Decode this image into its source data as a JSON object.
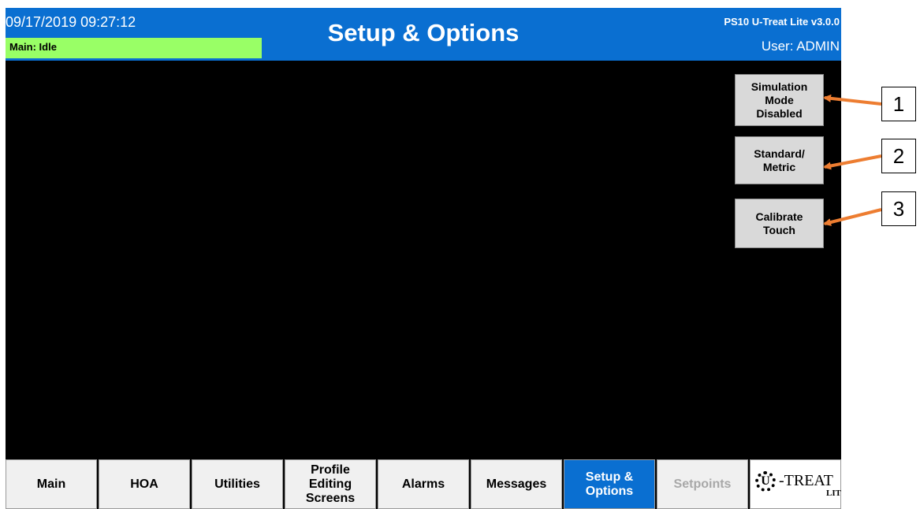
{
  "header": {
    "datetime": "09/17/2019 09:27:12",
    "status": "Main: Idle",
    "title": "Setup & Options",
    "version": "PS10 U-Treat Lite v3.0.0",
    "user": "User: ADMIN"
  },
  "side_buttons": {
    "simulation": "Simulation\nMode\nDisabled",
    "units": "Standard/\nMetric",
    "calibrate": "Calibrate\nTouch"
  },
  "tabs": [
    {
      "label": "Main"
    },
    {
      "label": "HOA"
    },
    {
      "label": "Utilities"
    },
    {
      "label": "Profile\nEditing\nScreens"
    },
    {
      "label": "Alarms"
    },
    {
      "label": "Messages"
    },
    {
      "label": "Setup &\nOptions"
    },
    {
      "label": "Setpoints"
    }
  ],
  "logo": {
    "mark": "U",
    "text": "-TREAT",
    "sub": "LITE"
  },
  "callouts": [
    "1",
    "2",
    "3"
  ],
  "colors": {
    "header_blue": "#0a6fd1",
    "status_green": "#99ff66",
    "arrow_orange": "#ed7d31"
  }
}
